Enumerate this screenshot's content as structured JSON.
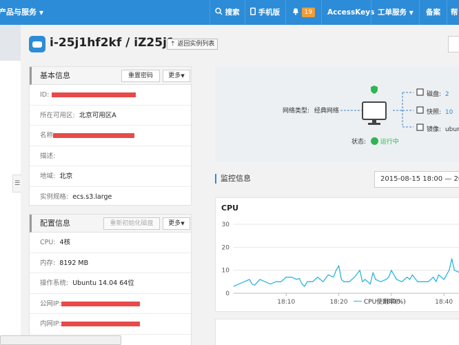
{
  "topbar": {
    "products_label": "产品与服务",
    "search_label": "搜索",
    "mobile_label": "手机版",
    "notification_count": "19",
    "accesskeys_label": "AccessKeys",
    "ticket_label": "工单服务",
    "beian_label": "备案",
    "help_label": "帮",
    "bg_color": "#2d8cd7"
  },
  "header": {
    "instance_title": "i-25j1hf2kf / iZ25j1...",
    "back_label": "返回实例列表"
  },
  "basic_info": {
    "title": "基本信息",
    "reset_password": "重置密码",
    "more": "更多",
    "rows": [
      {
        "label": "ID:",
        "value": ""
      },
      {
        "label": "所在可用区:",
        "value": "北京可用区A"
      },
      {
        "label": "名称",
        "value": ""
      },
      {
        "label": "描述:",
        "value": ""
      },
      {
        "label": "地域:",
        "value": "北京"
      },
      {
        "label": "实例规格:",
        "value": "ecs.s3.large"
      }
    ]
  },
  "config_info": {
    "title": "配置信息",
    "reinit_disk": "重新初始化磁盘",
    "more": "更多",
    "rows": [
      {
        "label": "CPU:",
        "value": "4核"
      },
      {
        "label": "内存:",
        "value": "8192 MB"
      },
      {
        "label": "操作系统:",
        "value": "Ubuntu 14.04 64位"
      },
      {
        "label": "公网IP:",
        "value": ""
      },
      {
        "label": "内网IP:",
        "value": ""
      }
    ]
  },
  "network": {
    "type_label": "网络类型:",
    "type_value": "经典网络",
    "status_label": "状态:",
    "status_value": "运行中",
    "status_color": "#2fb552",
    "disk_label": "磁盘:",
    "disk_value": "2",
    "snapshot_label": "快照:",
    "snapshot_value": "10",
    "image_label": "镜像:",
    "image_value": "ubun"
  },
  "monitor": {
    "title": "监控信息",
    "time_range": "2015-08-15 18:00  —  20"
  },
  "chart_data": {
    "type": "line",
    "title": "CPU",
    "ylim": [
      0,
      30
    ],
    "yticks": [
      "0",
      "10",
      "20",
      "30"
    ],
    "xticks": [
      {
        "label": "18:10",
        "minute": 10
      },
      {
        "label": "18:20",
        "minute": 20
      },
      {
        "label": "18:30",
        "minute": 30
      },
      {
        "label": "18:40",
        "minute": 40
      }
    ],
    "grid": true,
    "legend_position": "bottom",
    "series": [
      {
        "name": "CPU使用率(%)",
        "color": "#2cb5d8",
        "x": [
          0,
          1,
          2,
          3,
          3.5,
          4,
          5,
          6,
          7,
          8,
          9,
          10,
          11,
          12,
          12.5,
          13,
          13.5,
          14,
          15,
          16,
          17,
          18,
          19,
          19.5,
          20,
          20.5,
          21,
          22,
          23,
          24,
          24.5,
          25,
          26,
          26.5,
          27,
          28,
          29,
          29.5,
          30,
          31,
          32,
          33,
          33.5,
          34,
          35,
          36,
          37,
          38,
          38.5,
          39,
          40,
          41,
          41.5,
          42,
          43
        ],
        "values": [
          3,
          4,
          5,
          6,
          4,
          3.5,
          6,
          5,
          4,
          5,
          5,
          7,
          7,
          6,
          6.5,
          4,
          3,
          5,
          5,
          7,
          5,
          8,
          7,
          10,
          12,
          6,
          5,
          5,
          7,
          10,
          5,
          6,
          4,
          9,
          6,
          5,
          6,
          7,
          10,
          6,
          5,
          7,
          6,
          8,
          5,
          5,
          5,
          7,
          5,
          8,
          6,
          10,
          15,
          10,
          9
        ]
      }
    ]
  }
}
